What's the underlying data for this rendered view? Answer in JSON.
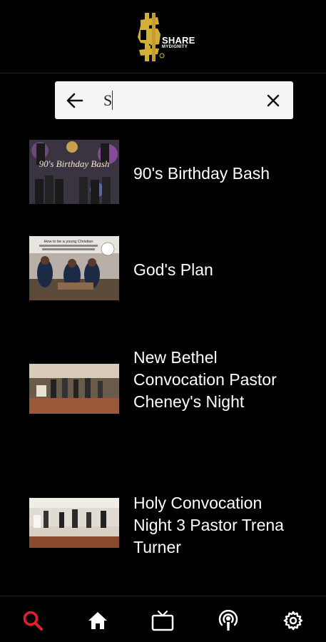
{
  "header": {
    "logo_line1": "SHARE",
    "logo_line2": "MYDIGNITY"
  },
  "search": {
    "query": "S",
    "back_icon": "arrow-left-icon",
    "clear_icon": "close-icon"
  },
  "results": [
    {
      "title": "90's Birthday Bash",
      "thumbnail_text": "90's Birthday Bash"
    },
    {
      "title": "God's Plan",
      "thumbnail_text": "How to be a young Christian"
    },
    {
      "title": "New Bethel Convocation Pastor Cheney's Night",
      "thumbnail_text": ""
    },
    {
      "title": "Holy Convocation Night 3 Pastor Trena Turner",
      "thumbnail_text": ""
    }
  ],
  "bottom_nav": {
    "items": [
      {
        "icon": "search-icon",
        "active": true
      },
      {
        "icon": "home-icon",
        "active": false
      },
      {
        "icon": "tv-icon",
        "active": false
      },
      {
        "icon": "podcast-icon",
        "active": false
      },
      {
        "icon": "gear-icon",
        "active": false
      }
    ],
    "active_color": "#e3202e"
  },
  "colors": {
    "background": "#000000",
    "search_bg": "#f5f5f5",
    "logo_gold": "#d4af37"
  }
}
